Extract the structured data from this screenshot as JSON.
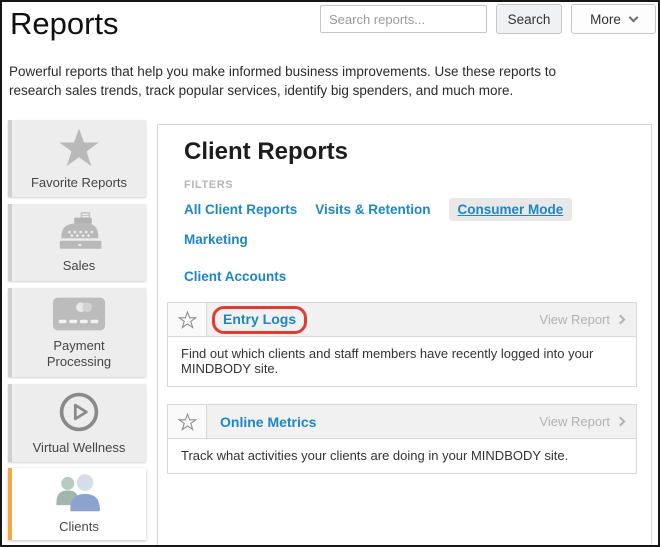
{
  "header": {
    "title": "Reports",
    "search_placeholder": "Search reports...",
    "search_button": "Search",
    "more_button": "More",
    "description": "Powerful reports that help you make informed business improvements. Use these reports to research sales trends, track popular services, identify big spenders, and much more."
  },
  "sidebar": {
    "items": [
      {
        "label": "Favorite Reports",
        "icon": "star-icon",
        "selected": false
      },
      {
        "label": "Sales",
        "icon": "cash-register-icon",
        "selected": false
      },
      {
        "label": "Payment Processing",
        "icon": "credit-card-icon",
        "selected": false
      },
      {
        "label": "Virtual Wellness",
        "icon": "play-circle-icon",
        "selected": false
      },
      {
        "label": "Clients",
        "icon": "clients-icon",
        "selected": true
      }
    ]
  },
  "main": {
    "title": "Client Reports",
    "filters_label": "FILTERS",
    "filters": [
      {
        "label": "All Client Reports",
        "selected": false
      },
      {
        "label": "Visits & Retention",
        "selected": false
      },
      {
        "label": "Consumer Mode",
        "selected": true
      },
      {
        "label": "Marketing",
        "selected": false
      },
      {
        "label": "Client Accounts",
        "selected": false
      }
    ],
    "view_report_label": "View Report",
    "reports": [
      {
        "name": "Entry Logs",
        "description": "Find out which clients and staff members have recently logged into your MINDBODY site.",
        "highlighted": true
      },
      {
        "name": "Online Metrics",
        "description": "Track what activities your clients are doing in your MINDBODY site.",
        "highlighted": false
      }
    ]
  },
  "colors": {
    "link_blue": "#1d86c7",
    "annotation_red": "#e23b32",
    "selected_tab_orange": "#f4a640",
    "tile_gray": "#ededed",
    "header_strip_gray": "#f1f1f1"
  }
}
